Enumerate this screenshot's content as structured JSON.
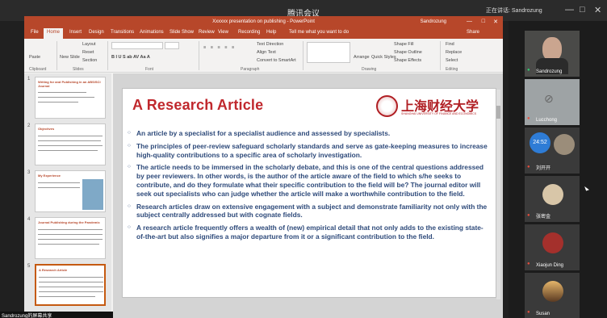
{
  "meeting": {
    "title": "腾讯会议",
    "speaker_label": "正在讲话: Sandrozung"
  },
  "ppt": {
    "window_title": "Xxxxxx presentation on publishing - PowerPoint",
    "user": "Sandrozung",
    "share": "Share",
    "tabs": [
      "File",
      "Home",
      "Insert",
      "Design",
      "Transitions",
      "Animations",
      "Slide Show",
      "Review",
      "View",
      "Recording",
      "Help",
      "Tell me what you want to do"
    ],
    "ribbon": {
      "paste": "Paste",
      "clipboard": "Clipboard",
      "new_slide": "New Slide",
      "layout": "Layout",
      "reset": "Reset",
      "section": "Section",
      "slides": "Slides",
      "font_buttons": "B  I  U  S  ab  AV  Aa  A",
      "font_group": "Font",
      "paragraph_group": "Paragraph",
      "text_direction": "Text Direction",
      "align_text": "Align Text",
      "convert_smartart": "Convert to SmartArt",
      "shape_fill": "Shape Fill",
      "shape_outline": "Shape Outline",
      "shape_effects": "Shape Effects",
      "arrange": "Arrange",
      "quick_styles": "Quick Styles",
      "drawing": "Drawing",
      "find": "Find",
      "replace": "Replace",
      "select": "Select",
      "editing": "Editing"
    },
    "thumbnails": [
      {
        "num": "1",
        "title": "Writing for and Publishing in an ABS/SCI Journal"
      },
      {
        "num": "2",
        "title": "Objectives"
      },
      {
        "num": "3",
        "title": "My Experience"
      },
      {
        "num": "4",
        "title": "Journal Publishing during the Pandemic"
      },
      {
        "num": "5",
        "title": "A Research Article"
      }
    ],
    "slide": {
      "title": "A Research Article",
      "logo_cn": "上海财经大学",
      "logo_en": "SHANGHAI UNIVERSITY OF FINANCE AND ECONOMICS",
      "bullets": [
        "An article by a specialist for a specialist audience and assessed by specialists.",
        "The principles of peer-review safeguard scholarly standards and serve as gate-keeping measures to increase high-quality contributions to a specific area of scholarly investigation.",
        "The article needs to be immersed in the scholarly debate, and this is one of the central questions addressed by peer reviewers. In other words, is the author of the article aware of the field to which s/he seeks to contribute, and do they formulate what their specific contribution to the field will be? The journal editor will seek out specialists who can judge whether the article will make a worthwhile contribution to the field.",
        "Research articles draw on extensive engagement with a subject and demonstrate familiarity not only with the subject centrally addressed but with cognate fields.",
        "A research article frequently offers a wealth of (new) empirical detail that not only adds to the existing state-of-the-art but also signifies a major departure from it or a significant contribution to the field."
      ]
    }
  },
  "participants": [
    {
      "name": "Sandrozung"
    },
    {
      "name": "Lucchong"
    },
    {
      "name": "刘开开",
      "timer": "24:52"
    },
    {
      "name": "张密金"
    },
    {
      "name": "Xiaojun Ding"
    },
    {
      "name": "Susan"
    }
  ],
  "caption": "Sandrozung的屏幕共享"
}
